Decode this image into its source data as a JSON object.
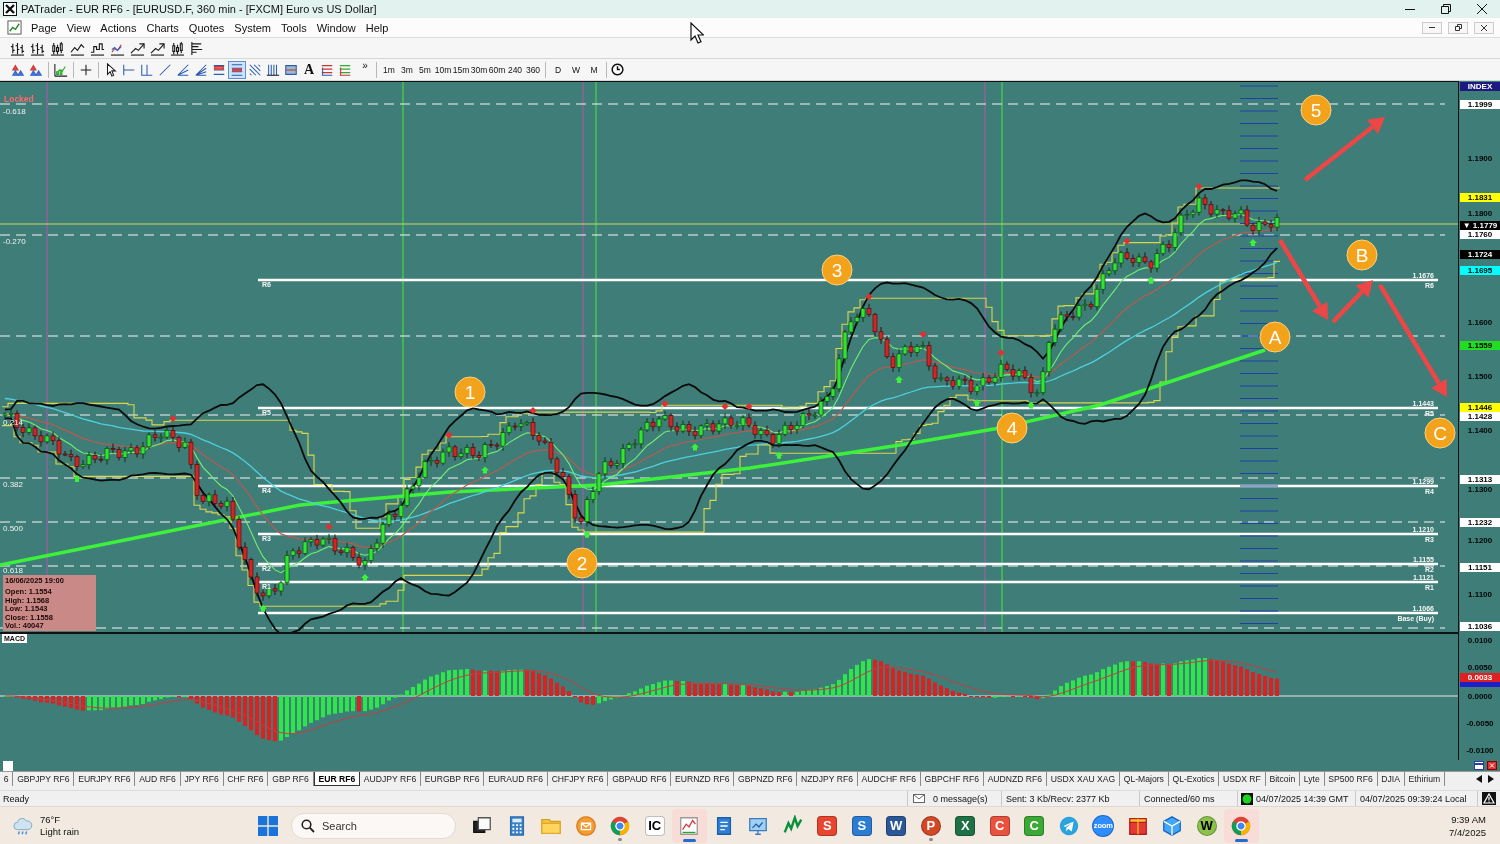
{
  "window": {
    "title": "PATrader - EUR RF6 - [EURUSD.F, 360 min - [FXCM] Euro vs US Dollar]"
  },
  "menu": [
    "Page",
    "View",
    "Actions",
    "Charts",
    "Quotes",
    "System",
    "Tools",
    "Window",
    "Help"
  ],
  "drawing_toolbar": {
    "tools": [
      {
        "kind": "shapes",
        "selected": false
      },
      {
        "kind": "shapes",
        "selected": false
      },
      {
        "kind": "zoomchart",
        "selected": false
      },
      {
        "kind": "crosshair",
        "selected": false
      },
      {
        "kind": "cursor",
        "selected": false
      },
      {
        "kind": "bracket",
        "selected": false
      },
      {
        "kind": "channel",
        "selected": false
      },
      {
        "kind": "trendline",
        "selected": false
      },
      {
        "kind": "fan",
        "selected": false
      },
      {
        "kind": "fan2",
        "selected": false
      },
      {
        "kind": "levels",
        "selected": false
      },
      {
        "kind": "levels2",
        "selected": true
      },
      {
        "kind": "hatch",
        "selected": false
      },
      {
        "kind": "vlines",
        "selected": false
      },
      {
        "kind": "range",
        "selected": false
      },
      {
        "kind": "text",
        "label": "A",
        "selected": false
      },
      {
        "kind": "fibo",
        "selected": false
      },
      {
        "kind": "fibo2",
        "selected": false
      }
    ],
    "more": "»",
    "timeframes": [
      "1m",
      "3m",
      "5m",
      "10m",
      "15m",
      "30m",
      "60m",
      "240",
      "360"
    ],
    "periods": [
      "D",
      "W",
      "M"
    ]
  },
  "chart": {
    "status": "Locked",
    "fib_labels": [
      "-0.618",
      "-0.270",
      "0.214",
      "0.382",
      "0.500",
      "0.618"
    ],
    "pivots": [
      {
        "left_label": "R6",
        "price": "1.1676",
        "name": "R6"
      },
      {
        "left_label": "R5",
        "price": "1.1443",
        "name": "R5"
      },
      {
        "left_label": "R4",
        "price": "1.1299",
        "name": "R4"
      },
      {
        "left_label": "R3",
        "price": "1.1210",
        "name": "R3"
      },
      {
        "left_label": "R2",
        "price": "1.1155",
        "name": "R2"
      },
      {
        "left_label": "R1",
        "price": "1.1121",
        "name": "R1"
      },
      {
        "price": "1.1066",
        "name": "Base (Buy)"
      }
    ],
    "info_box": {
      "time": "16/06/2025 19:00",
      "lines": [
        "Open: 1.1554",
        "High: 1.1568",
        "Low: 1.1543",
        "Close: 1.1558",
        "Vol.: 40047"
      ]
    },
    "waypoints": [
      "1",
      "2",
      "3",
      "4",
      "5",
      "A",
      "B",
      "C"
    ]
  },
  "price_axis": {
    "labels": [
      {
        "text": "INDEX",
        "color": "#1a1a80"
      },
      {
        "text": "1.1999",
        "color": "#ffffff"
      },
      {
        "text": "1.1900"
      },
      {
        "text": "1.1831",
        "color": "#ffff00"
      },
      {
        "text": "1.1800"
      },
      {
        "text": "▼ 1.1779",
        "color": "#000000"
      },
      {
        "text": "1.1760",
        "color": "#ffffff"
      },
      {
        "text": "1.1724",
        "color": "#000000"
      },
      {
        "text": "1.1695",
        "color": "#00ffff"
      },
      {
        "text": "1.1600"
      },
      {
        "text": "1.1559",
        "color": "#22dd22"
      },
      {
        "text": "1.1500"
      },
      {
        "text": "1.1446",
        "color": "#ffff00"
      },
      {
        "text": "1.1428",
        "color": "#ffffff"
      },
      {
        "text": "1.1400"
      },
      {
        "text": "1.1313",
        "color": "#ffffff"
      },
      {
        "text": "1.1300"
      },
      {
        "text": "1.1232",
        "color": "#ffffff"
      },
      {
        "text": "1.1200"
      },
      {
        "text": "1.1151",
        "color": "#ffffff"
      },
      {
        "text": "1.1100"
      },
      {
        "text": "1.1036",
        "color": "#ffffff"
      }
    ]
  },
  "macd": {
    "title": "MACD",
    "axis": [
      {
        "text": "0.0100"
      },
      {
        "text": "0.0050"
      },
      {
        "text": "0.0033",
        "color": "#e02020"
      },
      {
        "color": "#2020c8"
      },
      {
        "text": "0.0000"
      },
      {
        "text": "-0.0050"
      },
      {
        "text": "-0.0100"
      }
    ]
  },
  "symbol_tabs": [
    {
      "label": "6",
      "selected": false
    },
    {
      "label": "GBPJPY RF6",
      "selected": false
    },
    {
      "label": "EURJPY RF6",
      "selected": false
    },
    {
      "label": "AUD RF6",
      "selected": false
    },
    {
      "label": "JPY RF6",
      "selected": false
    },
    {
      "label": "CHF RF6",
      "selected": false
    },
    {
      "label": "GBP RF6",
      "selected": false
    },
    {
      "label": "EUR RF6",
      "selected": true
    },
    {
      "label": "AUDJPY RF6",
      "selected": false
    },
    {
      "label": "EURGBP RF6",
      "selected": false
    },
    {
      "label": "EURAUD RF6",
      "selected": false
    },
    {
      "label": "CHFJPY RF6",
      "selected": false
    },
    {
      "label": "GBPAUD RF6",
      "selected": false
    },
    {
      "label": "EURNZD RF6",
      "selected": false
    },
    {
      "label": "GBPNZD RF6",
      "selected": false
    },
    {
      "label": "NZDJPY RF6",
      "selected": false
    },
    {
      "label": "AUDCHF RF6",
      "selected": false
    },
    {
      "label": "GBPCHF RF6",
      "selected": false
    },
    {
      "label": "AUDNZD RF6",
      "selected": false
    },
    {
      "label": "USDX XAU XAG",
      "selected": false
    },
    {
      "label": "QL-Majors",
      "selected": false
    },
    {
      "label": "QL-Exotics",
      "selected": false
    },
    {
      "label": "USDX RF",
      "selected": false
    },
    {
      "label": "Bitcoin",
      "selected": false
    },
    {
      "label": "Lyte",
      "selected": false
    },
    {
      "label": "SP500 RF6",
      "selected": false
    },
    {
      "label": "DJIA",
      "selected": false
    },
    {
      "label": "Ethirium",
      "selected": false
    }
  ],
  "status_bar": {
    "text": "Ready",
    "messages": "0 message(s)",
    "traffic": "Sent: 3 Kb/Recv: 2377 Kb",
    "connection": "Connected/60 ms",
    "connected": true,
    "server_time": "04/07/2025 14:39 GMT",
    "local_time": "04/07/2025 09:39:24 Local"
  },
  "taskbar": {
    "weather": {
      "temperature": "76°F",
      "condition": "Light rain"
    },
    "search": {
      "placeholder": "Search"
    },
    "apps": [
      {
        "kind": "taskview",
        "running": false,
        "selected": false
      },
      {
        "kind": "calculator",
        "running": false,
        "selected": false
      },
      {
        "kind": "folder",
        "running": false,
        "selected": false
      },
      {
        "kind": "mail",
        "running": false,
        "selected": false
      },
      {
        "kind": "browser",
        "running": true,
        "selected": false
      },
      {
        "kind": "tile",
        "label": "IC",
        "color": "#ffffff",
        "running": false,
        "selected": false
      },
      {
        "kind": "chart",
        "running": false,
        "selected": true
      },
      {
        "kind": "notepad",
        "running": false,
        "selected": false
      },
      {
        "kind": "monitor",
        "running": false,
        "selected": false
      },
      {
        "kind": "stock",
        "running": false,
        "selected": false
      },
      {
        "kind": "tile",
        "label": "S",
        "color": "#e8452f",
        "running": false,
        "selected": false
      },
      {
        "kind": "tile",
        "label": "S",
        "color": "#2b7cd3",
        "running": false,
        "selected": false
      },
      {
        "kind": "tile",
        "label": "W",
        "color": "#2b5797",
        "running": false,
        "selected": false
      },
      {
        "kind": "round",
        "label": "P",
        "color": "#d24726",
        "running": true,
        "selected": false
      },
      {
        "kind": "tile",
        "label": "X",
        "color": "#1e7145",
        "running": false,
        "selected": false
      },
      {
        "kind": "tile",
        "label": "C",
        "color": "#e8523f",
        "running": false,
        "selected": false
      },
      {
        "kind": "tile",
        "label": "C",
        "color": "#3aa935",
        "running": false,
        "selected": false
      },
      {
        "kind": "plane",
        "running": false,
        "selected": false
      },
      {
        "kind": "round",
        "label": "zoom",
        "color": "#2d8cff",
        "running": false,
        "selected": false
      },
      {
        "kind": "box",
        "running": false,
        "selected": false
      },
      {
        "kind": "cube",
        "running": false,
        "selected": false
      },
      {
        "kind": "round",
        "label": "W",
        "color": "#8bc34a",
        "running": false,
        "selected": false
      },
      {
        "kind": "browser",
        "running": false,
        "selected": true
      }
    ],
    "time": "9:39 AM",
    "date": "7/4/2025"
  }
}
